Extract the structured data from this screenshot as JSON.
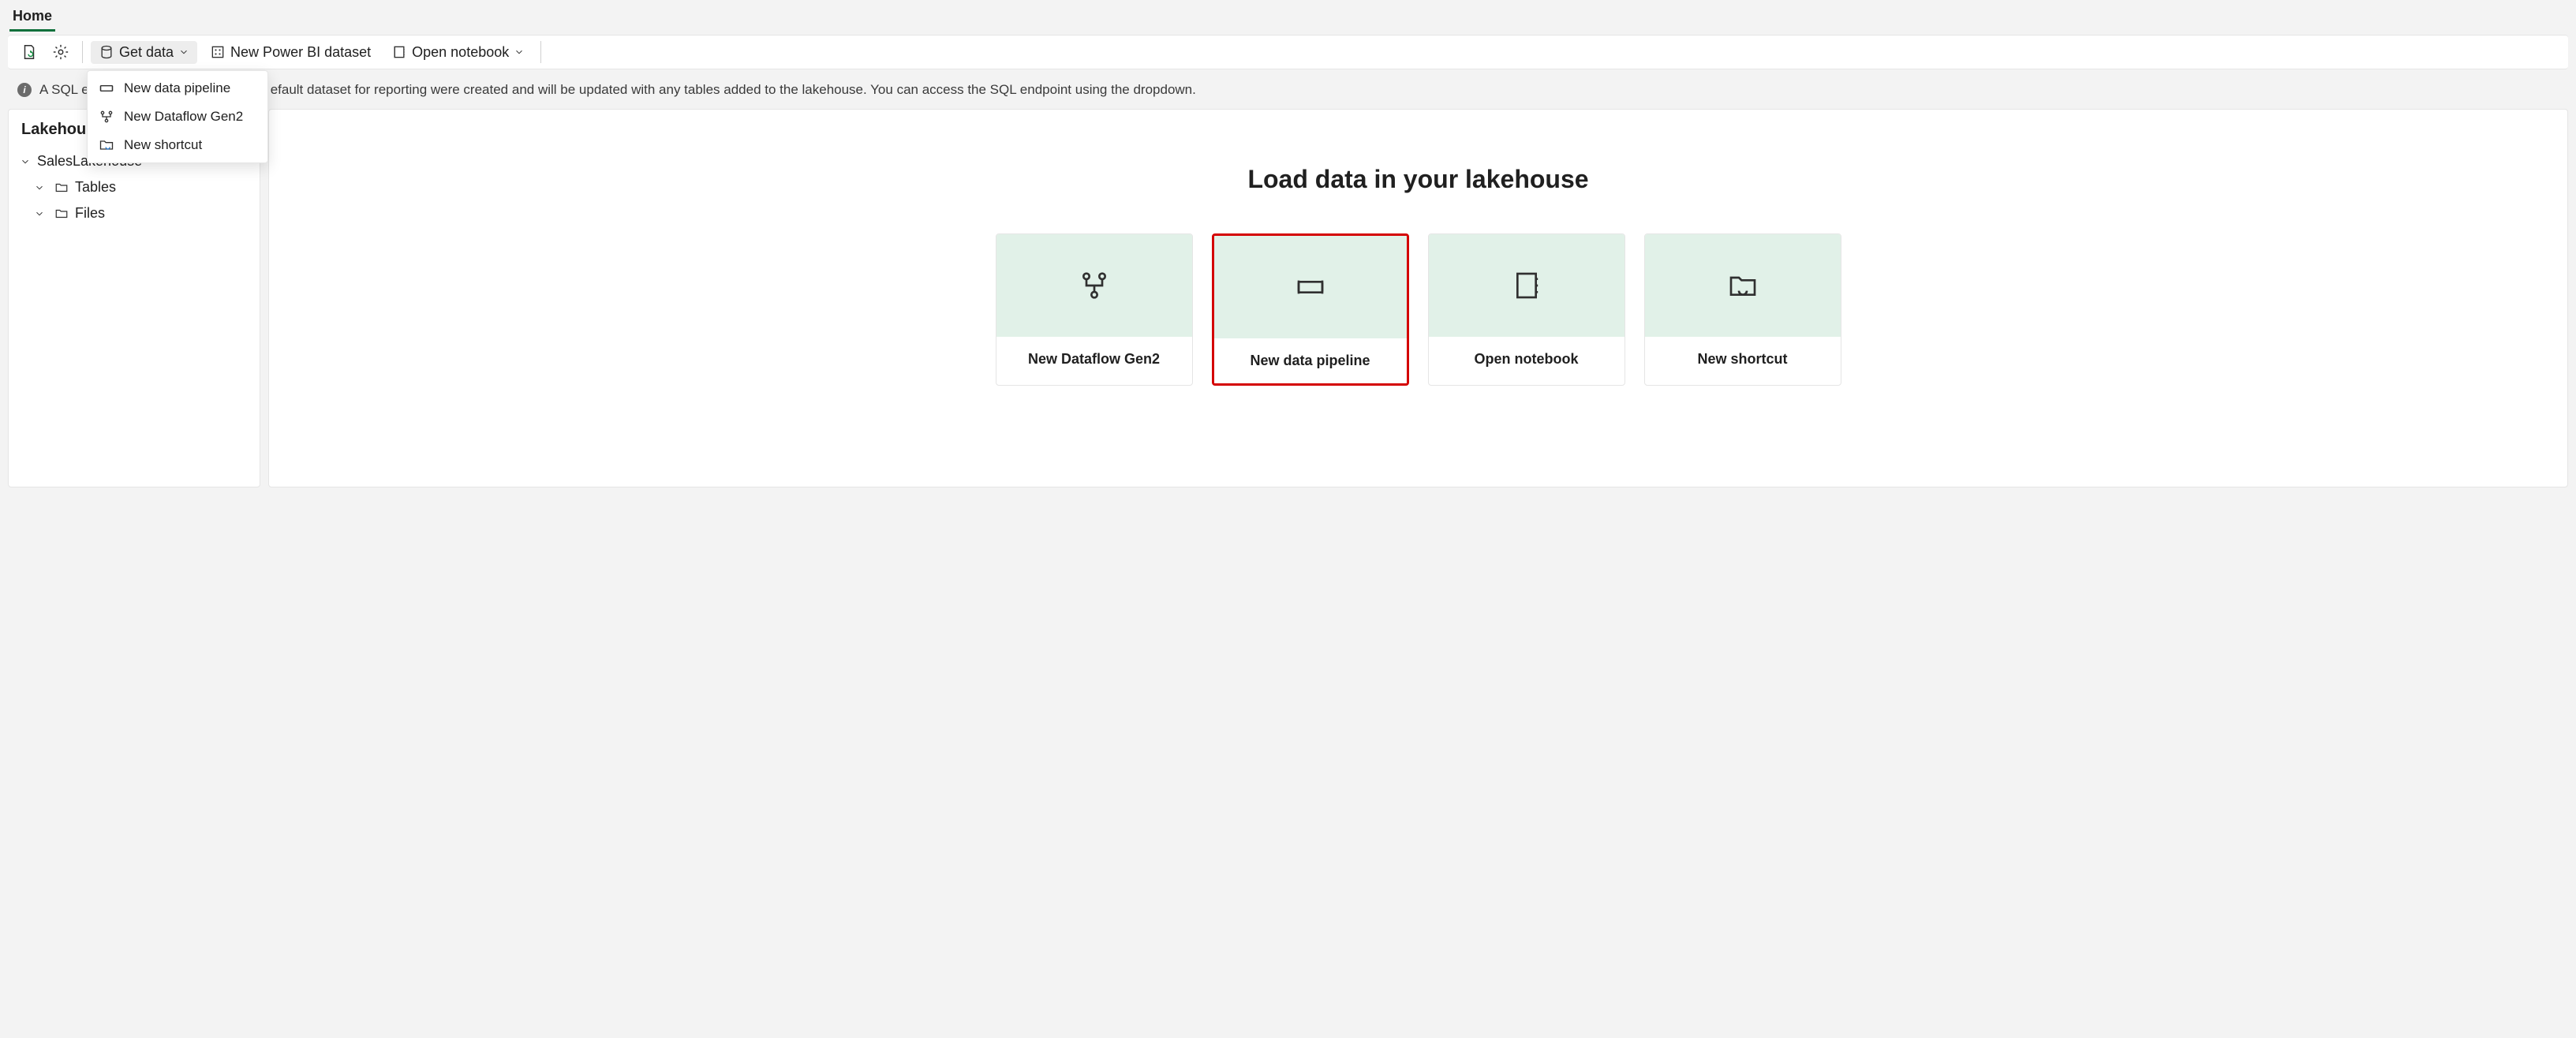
{
  "nav": {
    "home": "Home"
  },
  "ribbon": {
    "get_data": "Get data",
    "new_dataset": "New Power BI dataset",
    "open_notebook": "Open notebook"
  },
  "get_data_menu": {
    "pipeline": "New data pipeline",
    "dataflow": "New Dataflow Gen2",
    "shortcut": "New shortcut"
  },
  "banner": {
    "text_visible_prefix": "A SQL e",
    "text_visible_suffix": "efault dataset for reporting were created and will be updated with any tables added to the lakehouse. You can access the SQL endpoint using the dropdown."
  },
  "sidebar": {
    "title": "Lakehouse",
    "root": "SalesLakehouse",
    "tables": "Tables",
    "files": "Files"
  },
  "main": {
    "heading": "Load data in your lakehouse",
    "cards": {
      "dataflow": "New Dataflow Gen2",
      "pipeline": "New data pipeline",
      "notebook": "Open notebook",
      "shortcut": "New shortcut"
    }
  }
}
